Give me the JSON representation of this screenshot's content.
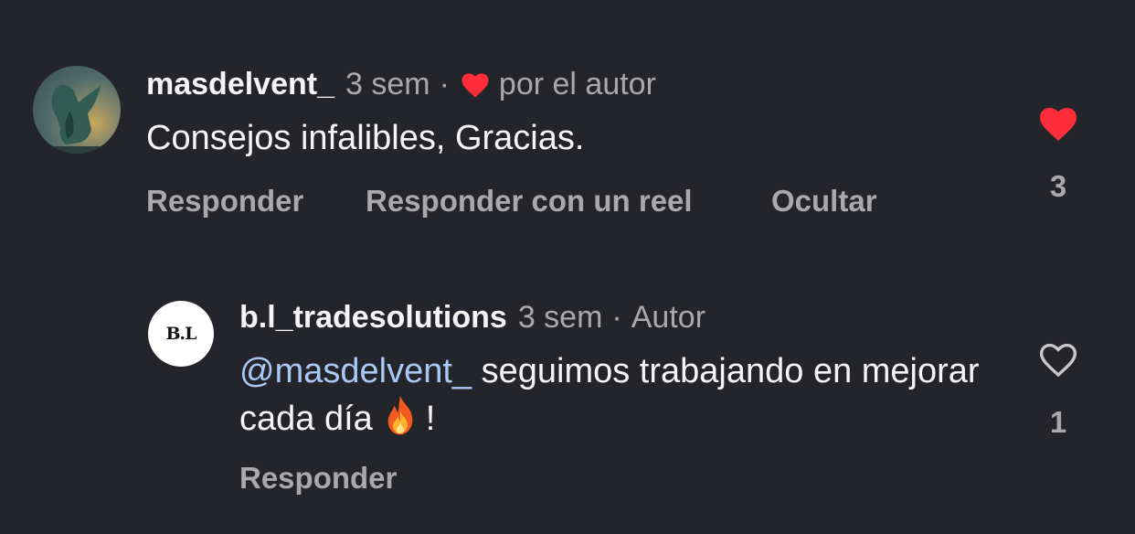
{
  "comments": [
    {
      "username": "masdelvent_",
      "time": "3 sem",
      "liked_by_author_label": "por el autor",
      "text": "Consejos infalibles, Gracias.",
      "actions": [
        "Responder",
        "Responder con un reel",
        "Ocultar"
      ],
      "likes": "3",
      "liked": true,
      "avatar_icon": "gargoyle-statue-avatar"
    },
    {
      "username": "b.l_tradesolutions",
      "time": "3 sem",
      "badge": "Autor",
      "avatar_logo": "B.L",
      "mention": "@masdelvent_",
      "text": " seguimos trabajando en mejorar cada día",
      "emoji": "fire-emoji",
      "trailing": "!",
      "actions": [
        "Responder"
      ],
      "likes": "1",
      "liked": false
    }
  ],
  "colors": {
    "background": "#24252a",
    "like_red": "#ff2d3a",
    "muted_text": "#a8a8ad",
    "mention_blue": "#a9c8f5"
  }
}
